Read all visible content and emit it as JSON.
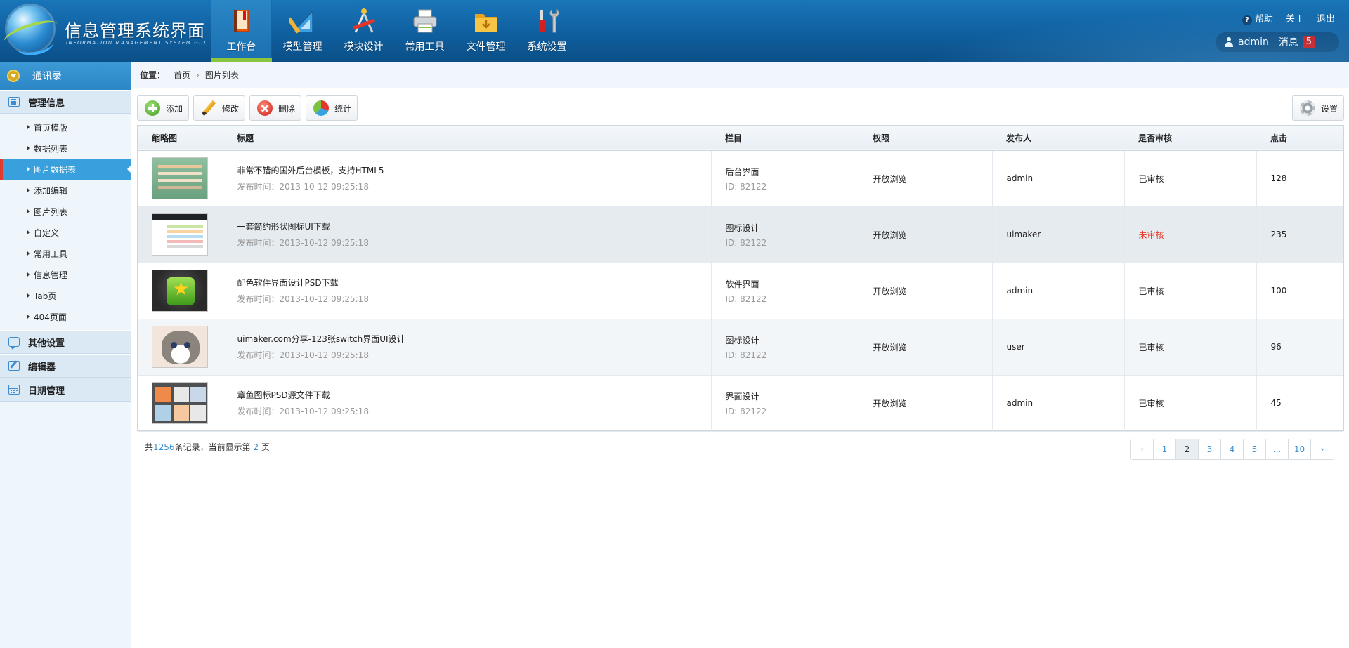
{
  "header": {
    "app_title": "信息管理系统界面",
    "app_subtitle": "INFORMATION MANAGEMENT SYSTEM GUI",
    "nav": [
      {
        "label": "工作台",
        "icon": "book-icon",
        "active": true
      },
      {
        "label": "模型管理",
        "icon": "ruler-triangle-icon",
        "active": false
      },
      {
        "label": "模块设计",
        "icon": "design-tools-icon",
        "active": false
      },
      {
        "label": "常用工具",
        "icon": "printer-icon",
        "active": false
      },
      {
        "label": "文件管理",
        "icon": "folder-icon",
        "active": false
      },
      {
        "label": "系统设置",
        "icon": "wrench-screwdriver-icon",
        "active": false
      }
    ],
    "links": {
      "help": "帮助",
      "about": "关于",
      "logout": "退出"
    },
    "user": {
      "name": "admin",
      "messages_label": "消息",
      "message_count": "5"
    }
  },
  "sidebar": {
    "top_header": "通讯录",
    "sections": [
      {
        "label": "管理信息",
        "icon": "list-icon"
      },
      {
        "label": "其他设置",
        "icon": "chat-icon"
      },
      {
        "label": "编辑器",
        "icon": "edit-icon"
      },
      {
        "label": "日期管理",
        "icon": "calendar-icon"
      }
    ],
    "items": [
      {
        "label": "首页模版",
        "active": false
      },
      {
        "label": "数据列表",
        "active": false
      },
      {
        "label": "图片数据表",
        "active": true
      },
      {
        "label": "添加编辑",
        "active": false
      },
      {
        "label": "图片列表",
        "active": false
      },
      {
        "label": "自定义",
        "active": false
      },
      {
        "label": "常用工具",
        "active": false
      },
      {
        "label": "信息管理",
        "active": false
      },
      {
        "label": "Tab页",
        "active": false
      },
      {
        "label": "404页面",
        "active": false
      }
    ]
  },
  "breadcrumb": {
    "label": "位置：",
    "items": [
      "首页",
      "图片列表"
    ]
  },
  "toolbar": {
    "add": "添加",
    "edit": "修改",
    "delete": "删除",
    "stats": "统计",
    "settings": "设置"
  },
  "table": {
    "headers": [
      "缩略图",
      "标题",
      "栏目",
      "权限",
      "发布人",
      "是否审核",
      "点击"
    ],
    "rows": [
      {
        "title": "非常不错的国外后台模板，支持HTML5",
        "date": "发布时间：2013-10-12 09:25:18",
        "column": "后台界面",
        "column_id": "ID: 82122",
        "permission": "开放浏览",
        "publisher": "admin",
        "review": "已审核",
        "clicks": "128"
      },
      {
        "title": "一套简约形状图标UI下载",
        "date": "发布时间：2013-10-12 09:25:18",
        "column": "图标设计",
        "column_id": "ID: 82122",
        "permission": "开放浏览",
        "publisher": "uimaker",
        "review": "未审核",
        "clicks": "235"
      },
      {
        "title": "配色软件界面设计PSD下载",
        "date": "发布时间：2013-10-12 09:25:18",
        "column": "软件界面",
        "column_id": "ID: 82122",
        "permission": "开放浏览",
        "publisher": "admin",
        "review": "已审核",
        "clicks": "100"
      },
      {
        "title": "uimaker.com分享-123张switch界面UI设计",
        "date": "发布时间：2013-10-12 09:25:18",
        "column": "图标设计",
        "column_id": "ID: 82122",
        "permission": "开放浏览",
        "publisher": "user",
        "review": "已审核",
        "clicks": "96"
      },
      {
        "title": "章鱼图标PSD源文件下载",
        "date": "发布时间：2013-10-12 09:25:18",
        "column": "界面设计",
        "column_id": "ID: 82122",
        "permission": "开放浏览",
        "publisher": "admin",
        "review": "已审核",
        "clicks": "45"
      }
    ]
  },
  "footer": {
    "prefix": "共",
    "total": "1256",
    "mid": "条记录，当前显示第",
    "page": "2",
    "suffix": "页"
  },
  "pager": {
    "prev": "‹",
    "pages": [
      "1",
      "2",
      "3",
      "4",
      "5",
      "...",
      "10"
    ],
    "current": "2",
    "next": "›"
  },
  "colors": {
    "accent": "#2b86c6",
    "active_green": "#8cc63e",
    "unreviewed": "#e53b2b",
    "link": "#3b8fd0"
  }
}
